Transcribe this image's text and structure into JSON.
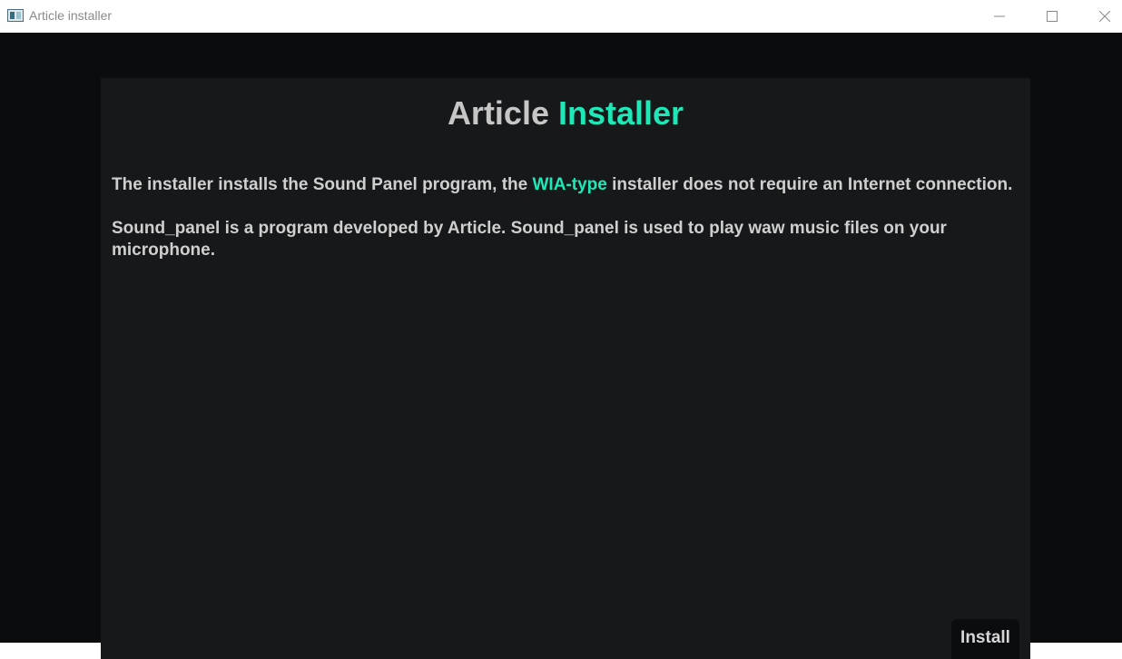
{
  "window": {
    "title": "Article installer"
  },
  "header": {
    "title_part1": "Article",
    "title_part2": "Installer"
  },
  "content": {
    "paragraph1_before": "The installer installs the Sound Panel program, the",
    "paragraph1_highlight": "WIA-type",
    "paragraph1_after": "installer does not require an Internet connection.",
    "paragraph2": "Sound_panel is a program developed by Article. Sound_panel is used to play waw music files on your microphone."
  },
  "actions": {
    "install_label": "Install"
  },
  "colors": {
    "accent": "#1ee8b8",
    "background": "#0b0c0e",
    "panel": "#17181a",
    "text": "#cfcfcf"
  },
  "icons": {
    "app": "app-window-icon",
    "minimize": "minimize-icon",
    "maximize": "maximize-icon",
    "close": "close-icon"
  }
}
